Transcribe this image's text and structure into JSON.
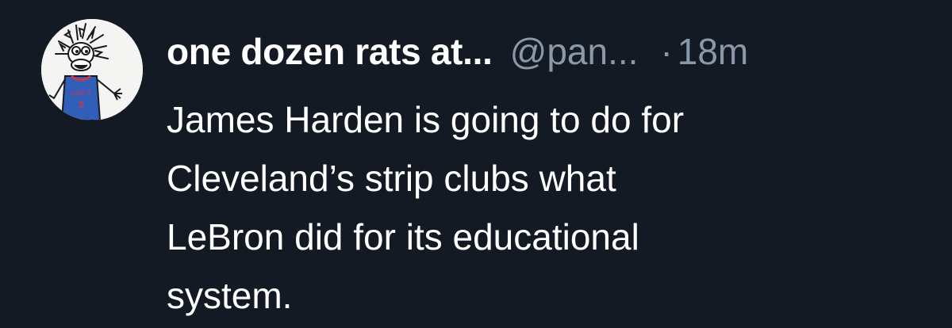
{
  "tweet": {
    "display_name": "one dozen rats at...",
    "handle": "@pan...",
    "separator": "·",
    "time": "18m",
    "text_lines": [
      "James Harden is going to do for",
      "Cleveland’s strip clubs what",
      "LeBron did for its educational",
      "system."
    ],
    "avatar": {
      "icon": "cartoon-rat-avatar-icon",
      "jersey_text": "PHILA",
      "jersey_number": "3"
    }
  },
  "colors": {
    "background": "#141a24",
    "primary_text": "#ffffff",
    "secondary_text": "#8b98a8",
    "jersey": "#2f5fb8",
    "jersey_trim": "#d6334a"
  }
}
